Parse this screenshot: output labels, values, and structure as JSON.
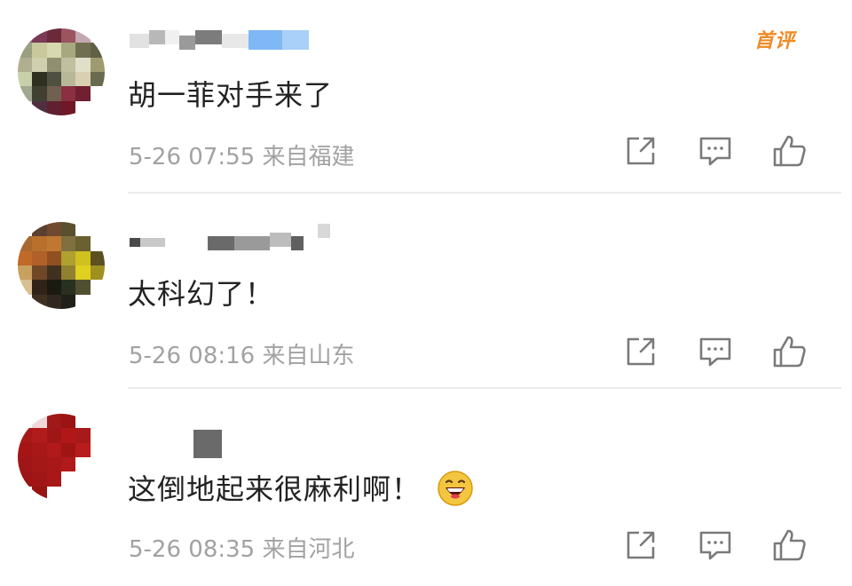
{
  "comments": [
    {
      "text": "胡一菲对手来了",
      "time": "5-26 07:55",
      "location": "来自福建",
      "badge": "首评",
      "badge_color": "#f08a24"
    },
    {
      "text": "太科幻了！",
      "time": "5-26 08:16",
      "location": "来自山东"
    },
    {
      "text": "这倒地起来很麻利啊！",
      "time": "5-26 08:35",
      "location": "来自河北",
      "emoji": "grinning-face-emoji"
    }
  ],
  "icons": [
    "share-icon",
    "comment-icon",
    "like-icon"
  ]
}
